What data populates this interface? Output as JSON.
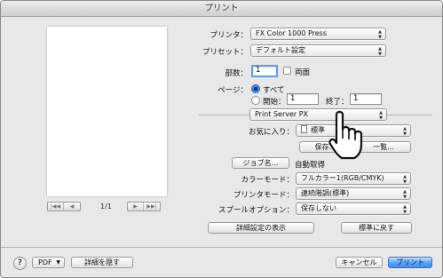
{
  "window": {
    "title": "プリント"
  },
  "preview": {
    "page_indicator": "1/1"
  },
  "printer": {
    "label": "プリンタ：",
    "value": "FX Color 1000 Press"
  },
  "preset": {
    "label": "プリセット：",
    "value": "デフォルト設定"
  },
  "copies": {
    "label": "部数：",
    "value": "1",
    "duplex_label": "両面"
  },
  "pages": {
    "label": "ページ：",
    "all_label": "すべて",
    "from_label": "開始：",
    "from_value": "1",
    "to_label": "終了：",
    "to_value": "1"
  },
  "panel_popup": {
    "value": "Print Server PX"
  },
  "favorites": {
    "label": "お気に入り：",
    "value": "標準",
    "save_label": "保存...",
    "list_label": "一覧..."
  },
  "job_name": {
    "button_label": "ジョブ名...",
    "value": "自動取得"
  },
  "color_mode": {
    "label": "カラーモード：",
    "value": "フルカラー1(RGB/CMYK)"
  },
  "print_mode": {
    "label": "プリンタモード：",
    "value": "連続階調(標準)"
  },
  "spool": {
    "label": "スプールオプション：",
    "value": "保存しない"
  },
  "detail_button": "詳細設定の表示",
  "reset_button": "標準に戻す",
  "footer": {
    "help": "?",
    "pdf_label": "PDF",
    "hide_details": "詳細を隠す",
    "cancel": "キャンセル",
    "print": "プリント"
  },
  "colors": {
    "accent": "#3e8ef2",
    "window_bg": "#e8e8e8"
  },
  "icons": [
    "help-icon",
    "document-icon",
    "pointing-hand-icon",
    "first-page-icon",
    "prev-page-icon",
    "next-page-icon",
    "last-page-icon"
  ]
}
